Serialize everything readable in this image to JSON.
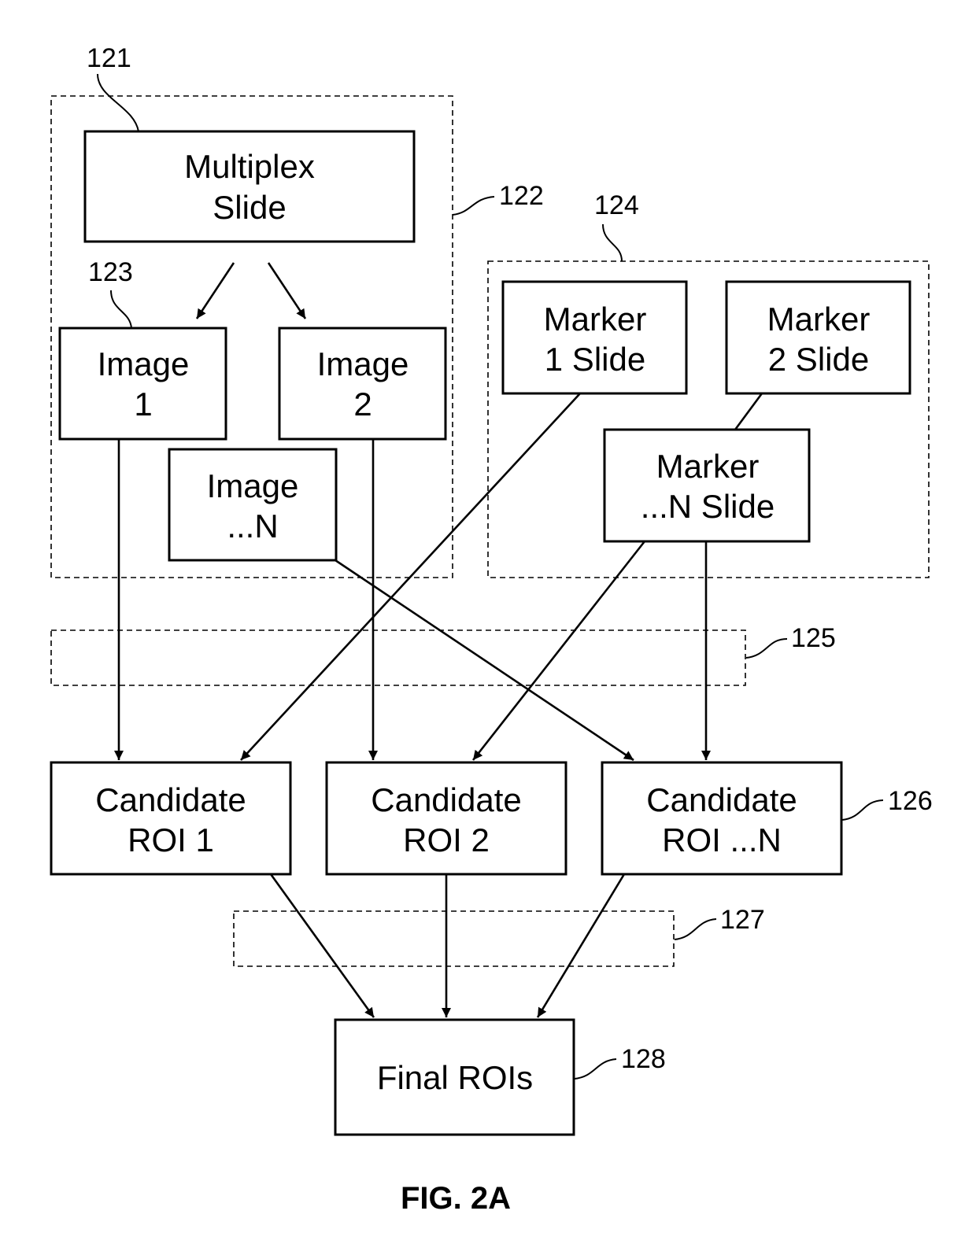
{
  "figure": {
    "caption": "FIG. 2A",
    "type": "flow-diagram"
  },
  "nodes": {
    "multiplex_slide": {
      "lines": [
        "Multiplex",
        "Slide"
      ]
    },
    "image_1": {
      "lines": [
        "Image",
        "1"
      ]
    },
    "image_2": {
      "lines": [
        "Image",
        "2"
      ]
    },
    "image_n": {
      "lines": [
        "Image",
        "...N"
      ]
    },
    "marker_1": {
      "lines": [
        "Marker",
        "1 Slide"
      ]
    },
    "marker_2": {
      "lines": [
        "Marker",
        "2 Slide"
      ]
    },
    "marker_n": {
      "lines": [
        "Marker",
        "...N Slide"
      ]
    },
    "candidate_1": {
      "lines": [
        "Candidate",
        "ROI 1"
      ]
    },
    "candidate_2": {
      "lines": [
        "Candidate",
        "ROI 2"
      ]
    },
    "candidate_n": {
      "lines": [
        "Candidate",
        "ROI ...N"
      ]
    },
    "final_rois": {
      "lines": [
        "Final ROIs"
      ]
    }
  },
  "groups": {
    "multiplex_group": {
      "ref": "122"
    },
    "marker_group": {
      "ref": "124"
    },
    "stage_125": {
      "ref": "125"
    },
    "stage_127": {
      "ref": "127"
    }
  },
  "references": {
    "r121": "121",
    "r122": "122",
    "r123": "123",
    "r124": "124",
    "r125": "125",
    "r126": "126",
    "r127": "127",
    "r128": "128"
  },
  "edges": [
    {
      "from": "multiplex_slide",
      "to": "image_1"
    },
    {
      "from": "multiplex_slide",
      "to": "image_2"
    },
    {
      "from": "image_1",
      "to": "candidate_1"
    },
    {
      "from": "marker_1",
      "to": "candidate_1"
    },
    {
      "from": "image_2",
      "to": "candidate_2"
    },
    {
      "from": "marker_n",
      "to": "candidate_2"
    },
    {
      "from": "image_n",
      "to": "candidate_n"
    },
    {
      "from": "marker_n",
      "to": "candidate_n"
    },
    {
      "from": "marker_2",
      "to": "marker_n",
      "arrow": false
    },
    {
      "from": "candidate_1",
      "to": "final_rois"
    },
    {
      "from": "candidate_2",
      "to": "final_rois"
    },
    {
      "from": "candidate_n",
      "to": "final_rois"
    }
  ]
}
